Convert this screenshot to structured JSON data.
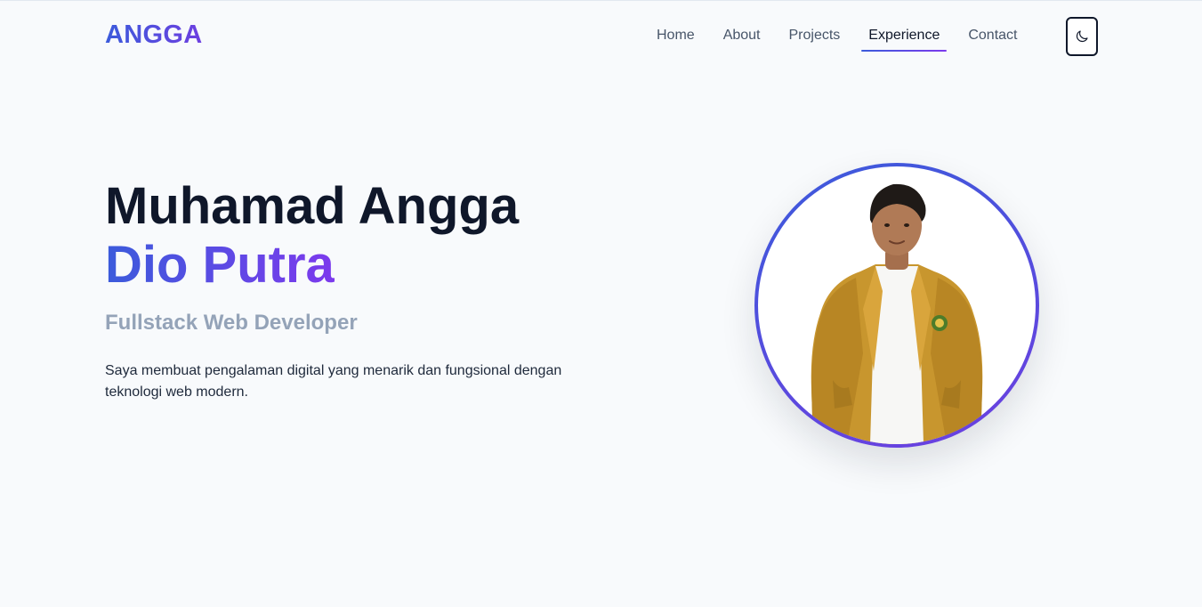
{
  "brand": {
    "logo": "ANGGA"
  },
  "nav": {
    "items": [
      {
        "label": "Home"
      },
      {
        "label": "About"
      },
      {
        "label": "Projects"
      },
      {
        "label": "Experience",
        "active": true
      },
      {
        "label": "Contact"
      }
    ],
    "theme_toggle_icon": "moon-icon"
  },
  "hero": {
    "name_line1": "Muhamad Angga",
    "name_line2": "Dio Putra",
    "role": "Fullstack Web Developer",
    "description": "Saya membuat pengalaman digital yang menarik dan fungsional dengan teknologi web modern.",
    "photo_icon": "profile-photo"
  },
  "colors": {
    "accent_start": "#3b5bdb",
    "accent_end": "#7c3aed",
    "background": "#f8fafc",
    "heading": "#0f172a",
    "muted": "#94a3b8"
  }
}
